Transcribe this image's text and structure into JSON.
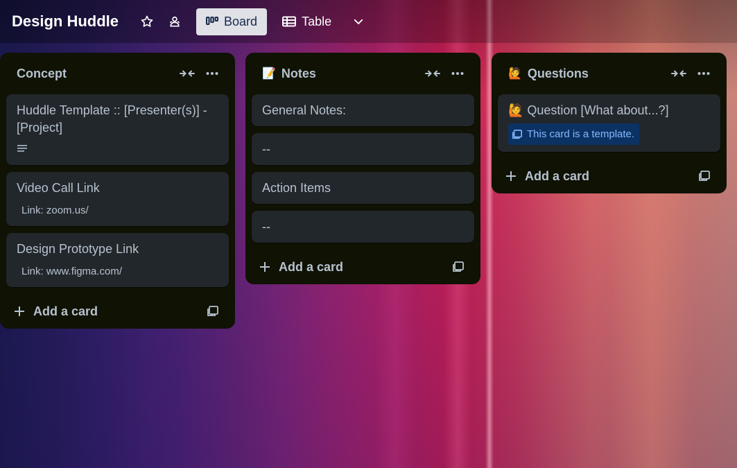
{
  "board": {
    "title": "Design Huddle"
  },
  "views": [
    {
      "label": "Board",
      "icon": "board-icon",
      "active": true
    },
    {
      "label": "Table",
      "icon": "table-icon",
      "active": false
    }
  ],
  "lists": [
    {
      "title": "Concept",
      "emoji": "",
      "cards": [
        {
          "title": "Huddle Template :: [Presenter(s)] - [Project]",
          "has_description": true
        },
        {
          "title": "Video Call Link",
          "sub": "Link: zoom.us/"
        },
        {
          "title": "Design Prototype Link",
          "sub": "Link: www.figma.com/"
        }
      ],
      "add_label": "Add a card"
    },
    {
      "title": "Notes",
      "emoji": "📝",
      "cards": [
        {
          "title": "General Notes:"
        },
        {
          "title": "--"
        },
        {
          "title": "Action Items"
        },
        {
          "title": "--"
        }
      ],
      "add_label": "Add a card"
    },
    {
      "title": "Questions",
      "emoji": "🙋",
      "cards": [
        {
          "title": "🙋 Question [What about...?]",
          "template_badge": "This card is a template."
        }
      ],
      "add_label": "Add a card"
    }
  ],
  "colors": {
    "list_bg": "#101204",
    "card_bg": "#22272b",
    "card_text": "#b6c2cf",
    "template_badge_bg": "#0c3263",
    "template_badge_text": "#85b8ff"
  }
}
